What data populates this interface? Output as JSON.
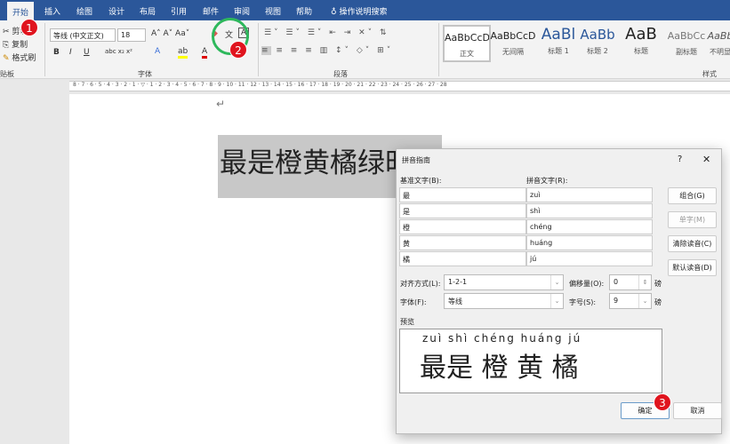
{
  "tabs": [
    "开始",
    "插入",
    "绘图",
    "设计",
    "布局",
    "引用",
    "邮件",
    "审阅",
    "视图",
    "帮助"
  ],
  "search_label": "操作说明搜索",
  "clipboard": {
    "cut": "剪切",
    "copy": "复制",
    "format_painter": "格式刷",
    "group": "贴板"
  },
  "font": {
    "name": "等线 (中文正文)",
    "size": "18",
    "group": "字体"
  },
  "paragraph": {
    "group": "段落"
  },
  "styles": {
    "group": "样式",
    "items": [
      {
        "sample": "AaBbCcD",
        "name": "正文"
      },
      {
        "sample": "AaBbCcD",
        "name": "无间隔"
      },
      {
        "sample": "AaBl",
        "name": "标题 1"
      },
      {
        "sample": "AaBb",
        "name": "标题 2"
      },
      {
        "sample": "AaB",
        "name": "标题"
      },
      {
        "sample": "AaBbCc",
        "name": "副标题"
      },
      {
        "sample": "AaBb",
        "name": "不明显"
      }
    ]
  },
  "ruler_text": "8 · 7 · 6 · 5 · 4 · 3 · 2 · 1 · ▽ · 1 · 2 · 3 · 4 · 5 · 6 · 7 · 8 · 9 · 10 · 11 · 12 · 13 · 14 · 15 · 16 · 17 · 18 · 19 · 20 · 21 · 22 · 23 · 24 · 25 · 26 · 27 · 28",
  "document": {
    "selected_text": "最是橙黄橘绿时"
  },
  "badges": [
    "1",
    "2",
    "3"
  ],
  "dialog": {
    "title": "拼音指南",
    "help": "?",
    "close": "✕",
    "base_label": "基准文字(B):",
    "ruby_label": "拼音文字(R):",
    "rows": [
      {
        "base": "最",
        "ruby": "zuì"
      },
      {
        "base": "是",
        "ruby": "shì"
      },
      {
        "base": "橙",
        "ruby": "chéng"
      },
      {
        "base": "黄",
        "ruby": "huáng"
      },
      {
        "base": "橘",
        "ruby": "jú"
      }
    ],
    "buttons": {
      "group": "组合(G)",
      "mono": "单字(M)",
      "clear": "清除读音(C)",
      "default": "默认读音(D)"
    },
    "align_label": "对齐方式(L):",
    "align_value": "1-2-1",
    "offset_label": "偏移量(O):",
    "offset_value": "0",
    "unit": "磅",
    "font_label": "字体(F):",
    "font_value": "等线",
    "size_label": "字号(S):",
    "size_value": "9",
    "preview_label": "预览",
    "preview_pinyin": "zuì shì chéng huáng jú",
    "preview_text": "最是 橙 黄 橘",
    "ok": "确定",
    "cancel": "取消"
  },
  "colors": {
    "tab_bar": "#2b579a",
    "badge": "#e0141e",
    "highlight_ring": "#2eb85c"
  }
}
